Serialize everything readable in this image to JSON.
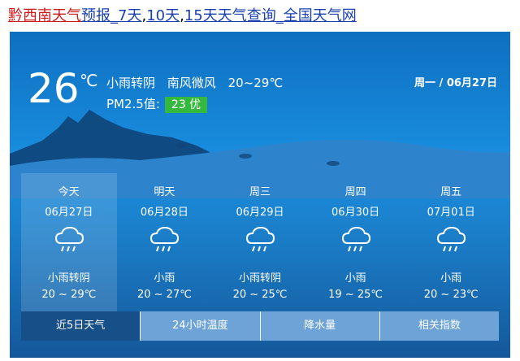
{
  "header": {
    "location": "黔西南天气",
    "links": [
      "预报_7天",
      "10天",
      "15天天气查询_全国天气网"
    ],
    "separators": [
      ",",
      ","
    ]
  },
  "current": {
    "temp": "26",
    "unit": "℃",
    "condition": "小雨转阴",
    "wind": "南风微风",
    "range": "20~29℃",
    "pm_label": "PM2.5值:",
    "pm_value": "23 优",
    "date": "周一 / 06月27日"
  },
  "days": [
    {
      "week": "今天",
      "date": "06月27日",
      "icon": "light-rain-icon",
      "cond": "小雨转阴",
      "range": "20 ~ 29℃"
    },
    {
      "week": "明天",
      "date": "06月28日",
      "icon": "light-rain-icon",
      "cond": "小雨",
      "range": "20 ~ 27℃"
    },
    {
      "week": "周三",
      "date": "06月29日",
      "icon": "light-rain-icon",
      "cond": "小雨转阴",
      "range": "20 ~ 25℃"
    },
    {
      "week": "周四",
      "date": "06月30日",
      "icon": "light-rain-icon",
      "cond": "小雨",
      "range": "19 ~ 25℃"
    },
    {
      "week": "周五",
      "date": "07月01日",
      "icon": "light-rain-icon",
      "cond": "小雨",
      "range": "20 ~ 23℃"
    }
  ],
  "tabs": [
    "近5日天气",
    "24小时温度",
    "降水量",
    "相关指数"
  ],
  "colors": {
    "accent": "#35b83e",
    "active_tab": "#174f88",
    "tab": "#6da3d6",
    "link": "#1a3fb0",
    "location": "#d11a1a"
  }
}
